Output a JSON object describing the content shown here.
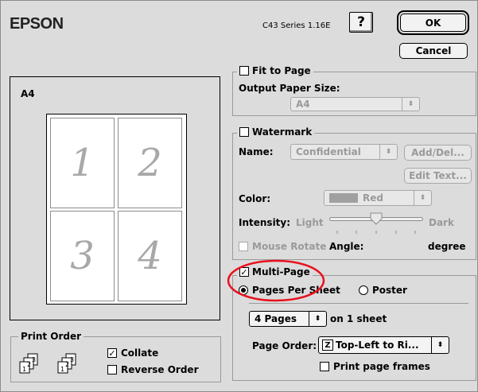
{
  "header": {
    "brand": "EPSON",
    "version": "C43 Series 1.16E",
    "help_label": "?",
    "ok_label": "OK",
    "cancel_label": "Cancel"
  },
  "preview": {
    "paper_label": "A4",
    "pages": [
      "1",
      "2",
      "3",
      "4"
    ]
  },
  "print_order": {
    "title": "Print Order",
    "collate_label": "Collate",
    "collate_checked": true,
    "reverse_label": "Reverse Order",
    "reverse_checked": false
  },
  "fit_to_page": {
    "title": "Fit to Page",
    "checked": false,
    "output_label": "Output Paper Size:",
    "output_value": "A4"
  },
  "watermark": {
    "title": "Watermark",
    "checked": false,
    "name_label": "Name:",
    "name_value": "Confidential",
    "add_del_label": "Add/Del...",
    "edit_text_label": "Edit Text...",
    "color_label": "Color:",
    "color_value": "Red",
    "intensity_label": "Intensity:",
    "light_label": "Light",
    "dark_label": "Dark",
    "intensity_level": 0.5,
    "mouse_rotate_label": "Mouse Rotate",
    "angle_label": "Angle:",
    "degree_label": "degree"
  },
  "multi_page": {
    "title": "Multi-Page",
    "checked": true,
    "pages_per_sheet_label": "Pages Per Sheet",
    "poster_label": "Poster",
    "selected_mode": "pages_per_sheet",
    "pages_value": "4 Pages",
    "on_sheet_label": "on 1 sheet",
    "page_order_label": "Page Order:",
    "page_order_value": "Top-Left to Ri...",
    "frames_label": "Print page frames",
    "frames_checked": false
  },
  "colors": {
    "background": "#dcdcdc",
    "highlight_circle": "#e8121e",
    "swatch_red_disabled": "#a0a0a0"
  }
}
